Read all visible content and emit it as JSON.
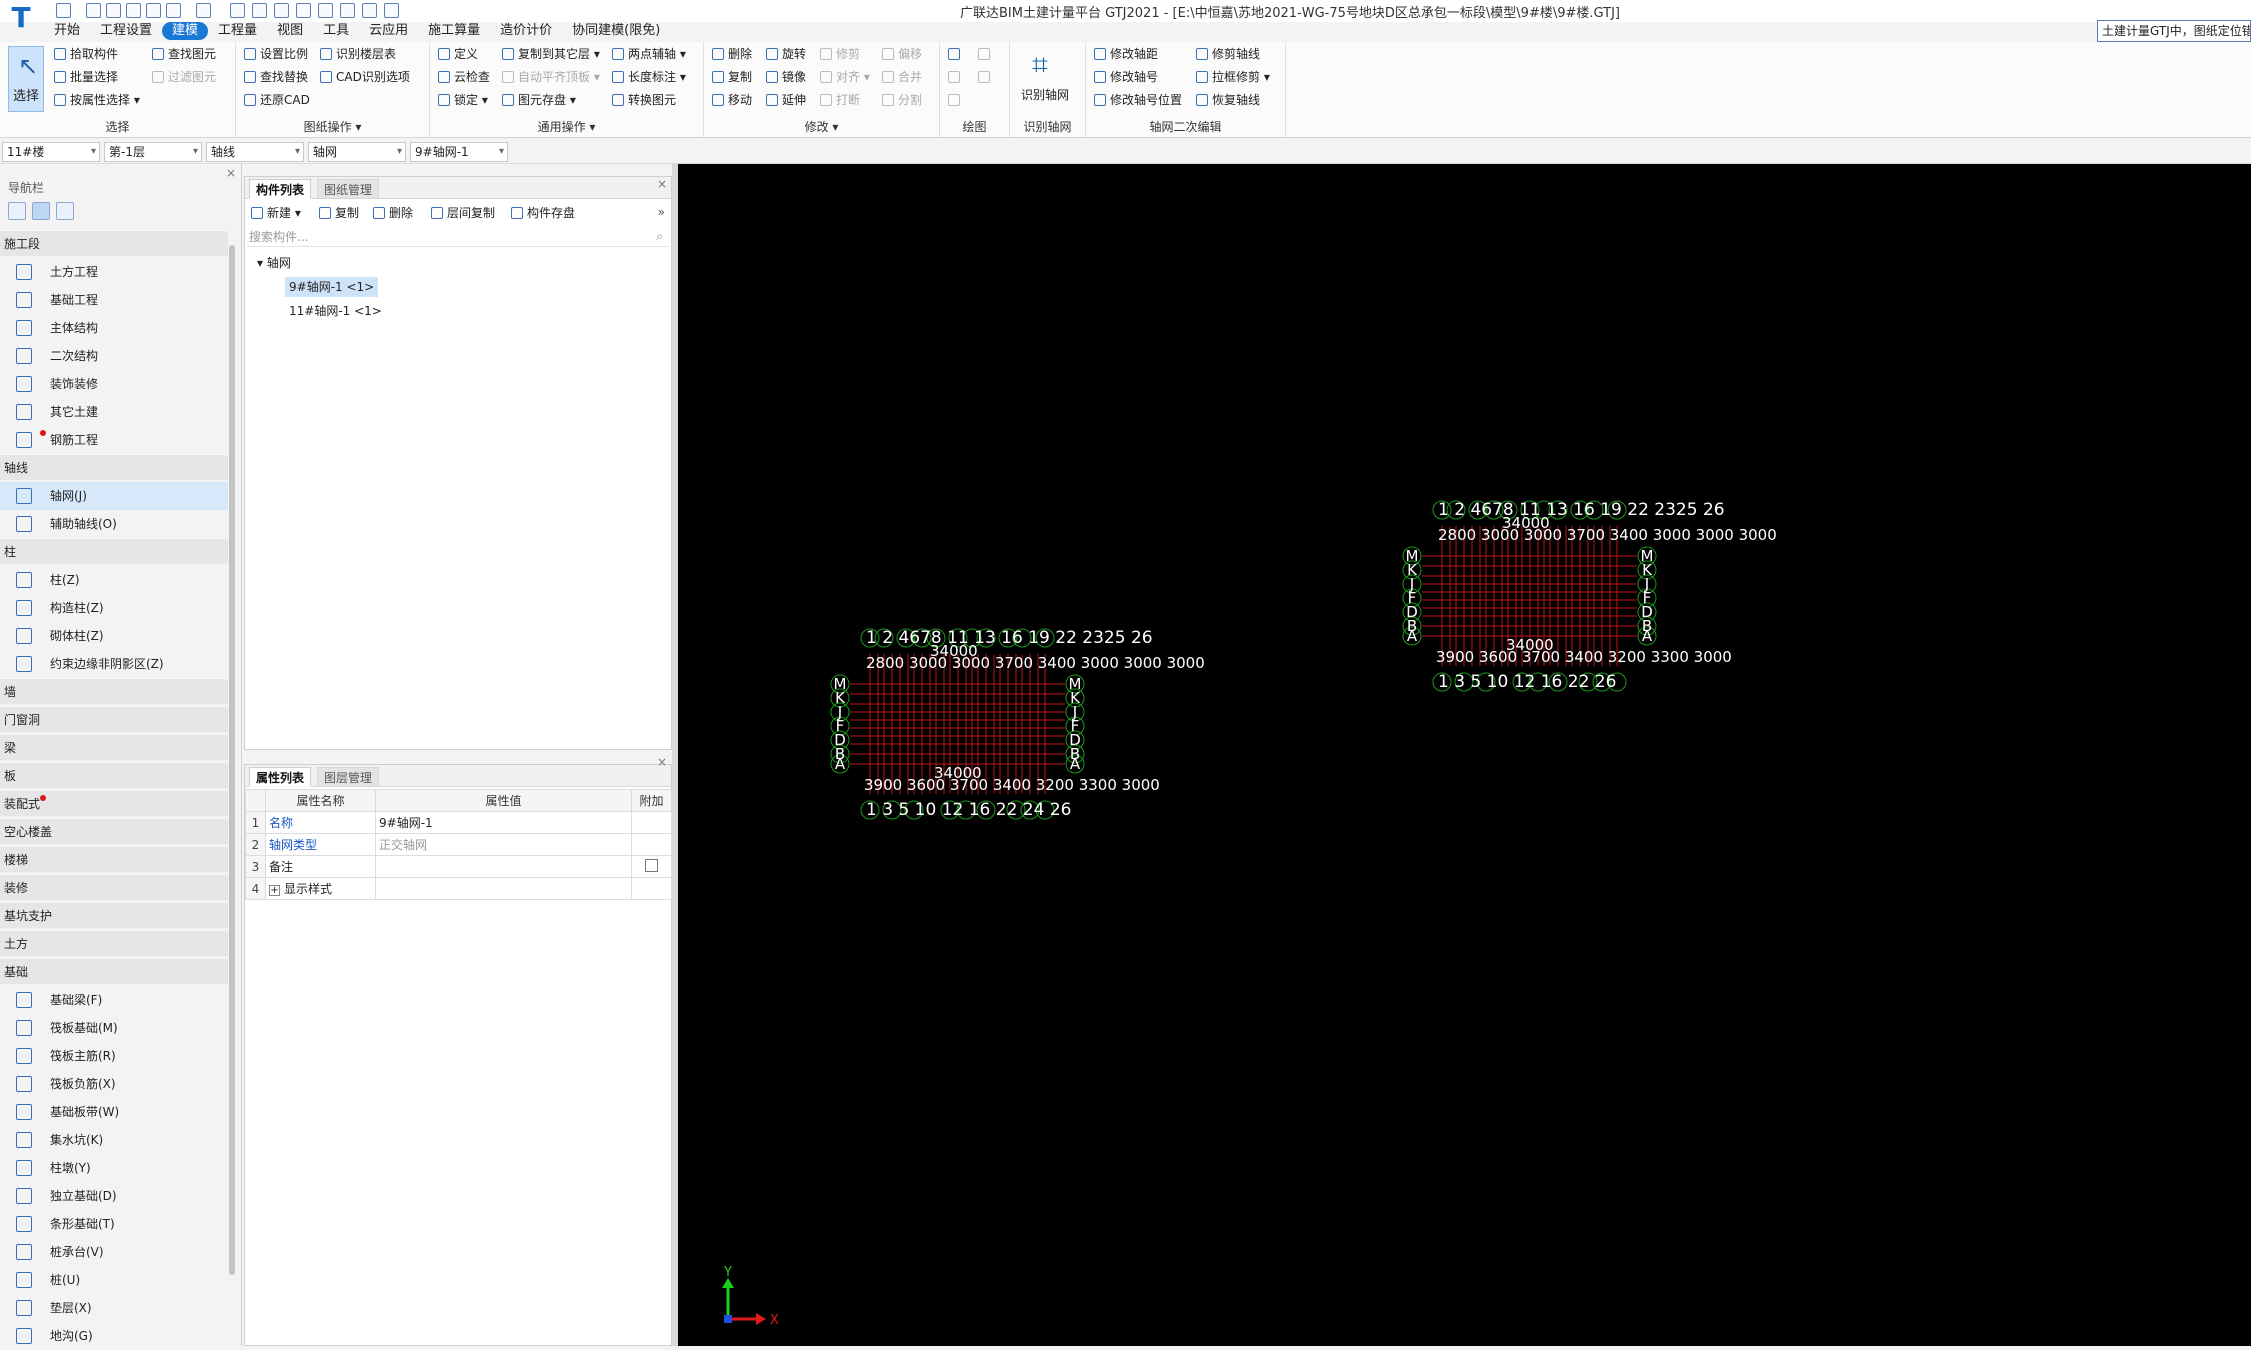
{
  "title": {
    "text": "广联达BIM土建计量平台 GTJ2021 - [E:\\中恒嘉\\苏地2021-WG-75号地块D区总承包一标段\\模型\\9#楼\\9#楼.GTJ]",
    "notice": "土建计量GTJ中，图纸定位错"
  },
  "menu": [
    "开始",
    "工程设置",
    "建模",
    "工程量",
    "视图",
    "工具",
    "云应用",
    "施工算量",
    "造价计价",
    "协同建模(限免)"
  ],
  "ribbon": {
    "select": {
      "select_label": "选择",
      "pick": "拾取构件",
      "batch": "批量选择",
      "by_attr": "按属性选择",
      "find": "查找图元",
      "filter": "过滤图元",
      "title": "选择"
    },
    "drawing": {
      "scale": "设置比例",
      "find_replace": "查找替换",
      "restore": "还原CAD",
      "id_floor": "识别楼层表",
      "cad_opt": "CAD识别选项",
      "title": "图纸操作"
    },
    "general": {
      "define": "定义",
      "cloud_check": "云检查",
      "lock": "锁定",
      "copy_floor": "复制到其它层",
      "auto_flat": "自动平齐顶板",
      "elem_save": "图元存盘",
      "two_point": "两点辅轴",
      "len_mark": "长度标注",
      "convert": "转换图元",
      "title": "通用操作"
    },
    "modify": {
      "delete": "删除",
      "copy": "复制",
      "move": "移动",
      "rotate": "旋转",
      "mirror": "镜像",
      "extend": "延伸",
      "trim": "修剪",
      "align": "对齐",
      "break": "打断",
      "offset": "偏移",
      "merge": "合并",
      "split": "分割",
      "title": "修改"
    },
    "draw": {
      "title": "绘图"
    },
    "id_grid": {
      "label": "识别轴网",
      "title": "识别轴网"
    },
    "grid_edit": {
      "mod_dist": "修改轴距",
      "mod_no": "修改轴号",
      "mod_pos": "修改轴号位置",
      "trim_axis": "修剪轴线",
      "drag_trim": "拉框修剪",
      "restore_axis": "恢复轴线",
      "title": "轴网二次编辑"
    }
  },
  "selectors": [
    "11#楼",
    "第-1层",
    "轴线",
    "轴网",
    "9#轴网-1"
  ],
  "nav": {
    "title": "导航栏",
    "items": [
      {
        "type": "cat",
        "label": "施工段"
      },
      {
        "type": "item",
        "label": "土方工程"
      },
      {
        "type": "item",
        "label": "基础工程"
      },
      {
        "type": "item",
        "label": "主体结构"
      },
      {
        "type": "item",
        "label": "二次结构"
      },
      {
        "type": "item",
        "label": "装饰装修"
      },
      {
        "type": "item",
        "label": "其它土建"
      },
      {
        "type": "item",
        "label": "钢筋工程",
        "dot": true
      },
      {
        "type": "cat",
        "label": "轴线"
      },
      {
        "type": "item",
        "label": "轴网(J)",
        "selected": true
      },
      {
        "type": "item",
        "label": "辅助轴线(O)"
      },
      {
        "type": "cat",
        "label": "柱"
      },
      {
        "type": "item",
        "label": "柱(Z)"
      },
      {
        "type": "item",
        "label": "构造柱(Z)"
      },
      {
        "type": "item",
        "label": "砌体柱(Z)"
      },
      {
        "type": "item",
        "label": "约束边缘非阴影区(Z)"
      },
      {
        "type": "cat",
        "label": "墙"
      },
      {
        "type": "cat",
        "label": "门窗洞"
      },
      {
        "type": "cat",
        "label": "梁"
      },
      {
        "type": "cat",
        "label": "板"
      },
      {
        "type": "cat",
        "label": "装配式",
        "dot": true
      },
      {
        "type": "cat",
        "label": "空心楼盖"
      },
      {
        "type": "cat",
        "label": "楼梯"
      },
      {
        "type": "cat",
        "label": "装修"
      },
      {
        "type": "cat",
        "label": "基坑支护"
      },
      {
        "type": "cat",
        "label": "土方"
      },
      {
        "type": "cat",
        "label": "基础"
      },
      {
        "type": "item",
        "label": "基础梁(F)"
      },
      {
        "type": "item",
        "label": "筏板基础(M)"
      },
      {
        "type": "item",
        "label": "筏板主筋(R)"
      },
      {
        "type": "item",
        "label": "筏板负筋(X)"
      },
      {
        "type": "item",
        "label": "基础板带(W)"
      },
      {
        "type": "item",
        "label": "集水坑(K)"
      },
      {
        "type": "item",
        "label": "柱墩(Y)"
      },
      {
        "type": "item",
        "label": "独立基础(D)"
      },
      {
        "type": "item",
        "label": "条形基础(T)"
      },
      {
        "type": "item",
        "label": "桩承台(V)"
      },
      {
        "type": "item",
        "label": "桩(U)"
      },
      {
        "type": "item",
        "label": "垫层(X)"
      },
      {
        "type": "item",
        "label": "地沟(G)"
      }
    ]
  },
  "component_panel": {
    "tabs": [
      "构件列表",
      "图纸管理"
    ],
    "tools": [
      "新建",
      "复制",
      "删除",
      "层间复制",
      "构件存盘"
    ],
    "search_placeholder": "搜索构件...",
    "tree_root": "轴网",
    "tree_items": [
      "9#轴网-1 <1>",
      "11#轴网-1 <1>"
    ]
  },
  "property_panel": {
    "tabs": [
      "属性列表",
      "图层管理"
    ],
    "headers": [
      "属性名称",
      "属性值",
      "附加"
    ],
    "rows": [
      {
        "num": "1",
        "name": "名称",
        "value": "9#轴网-1"
      },
      {
        "num": "2",
        "name": "轴网类型",
        "value": "正交轴网"
      },
      {
        "num": "3",
        "name": "备注",
        "value": ""
      },
      {
        "num": "4",
        "name": "显示样式",
        "value": ""
      }
    ]
  },
  "canvas": {
    "axis_x": "X",
    "axis_y": "Y",
    "grid_a": {
      "top_nums": "1 2 4678 11 13 16 19 22 2325 26",
      "top_dims": "2800 3000 3000 3700 3400 3000 3000 3000",
      "total": "34000",
      "bottom_dims": "3900 3600 3700 3400 3200 3300 3000",
      "bottom_nums": "1 3 5 10 12 16 22 24 26",
      "left_letters": [
        "M",
        "K",
        "J",
        "F",
        "D",
        "B",
        "A"
      ],
      "right_letters": [
        "M",
        "K",
        "J",
        "F",
        "D",
        "B",
        "A"
      ]
    },
    "grid_b": {
      "top_nums": "1 2 4678 11 13 16 19 22 2325 26",
      "top_dims": "2800 3000 3000 3700 3400 3000 3000 3000",
      "total": "34000",
      "bottom_dims": "3900 3600 3700 3400 3200 3300 3000",
      "bottom_nums": "1 3 5 10 12 16 22 26",
      "left_letters": [
        "M",
        "K",
        "J",
        "F",
        "D",
        "B",
        "A"
      ],
      "right_letters": [
        "M",
        "K",
        "J",
        "F",
        "D",
        "B",
        "A"
      ]
    }
  }
}
